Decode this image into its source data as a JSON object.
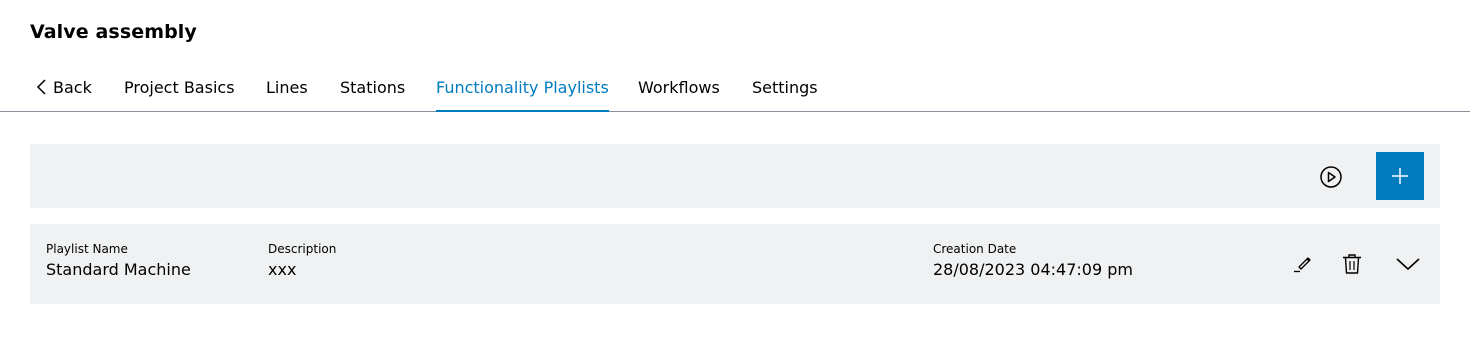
{
  "page": {
    "title": "Valve assembly"
  },
  "tabs": {
    "back_label": "Back",
    "items": [
      {
        "label": "Project Basics",
        "active": false
      },
      {
        "label": "Lines",
        "active": false
      },
      {
        "label": "Stations",
        "active": false
      },
      {
        "label": "Functionality Playlists",
        "active": true
      },
      {
        "label": "Workflows",
        "active": false
      },
      {
        "label": "Settings",
        "active": false
      }
    ]
  },
  "toolbar": {
    "play_icon": "play-circle-icon",
    "add_icon": "plus-icon"
  },
  "playlist": {
    "columns": {
      "name_label": "Playlist Name",
      "description_label": "Description",
      "creation_date_label": "Creation Date"
    },
    "rows": [
      {
        "name": "Standard Machine",
        "description": "xxx",
        "creation_date": "28/08/2023 04:47:09 pm"
      }
    ],
    "row_actions": {
      "edit_icon": "pencil-icon",
      "delete_icon": "trash-icon",
      "expand_icon": "chevron-down-icon"
    }
  },
  "colors": {
    "accent": "#007bc0",
    "panel_background": "#eff1f2",
    "divider": "#8a9099"
  }
}
